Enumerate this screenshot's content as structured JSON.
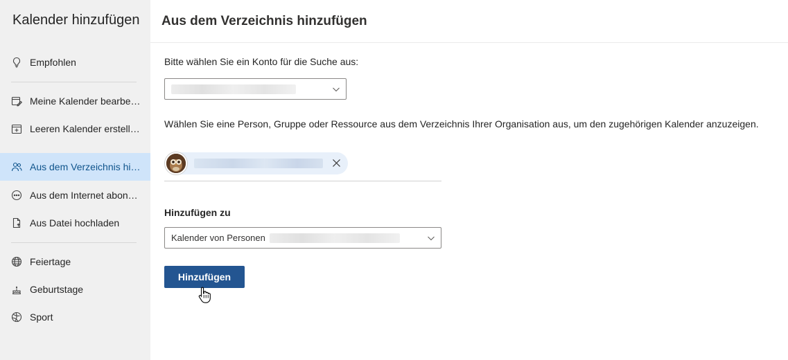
{
  "sidebar": {
    "title": "Kalender hinzufügen",
    "items": [
      {
        "label": "Empfohlen",
        "icon": "lightbulb-icon"
      },
      {
        "label": "Meine Kalender bearbeiten",
        "icon": "calendar-edit-icon"
      },
      {
        "label": "Leeren Kalender erstellen",
        "icon": "calendar-add-icon"
      },
      {
        "label": "Aus dem Verzeichnis hinzufügen",
        "icon": "people-directory-icon"
      },
      {
        "label": "Aus dem Internet abonnieren",
        "icon": "globe-subscribe-icon"
      },
      {
        "label": "Aus Datei hochladen",
        "icon": "document-upload-icon"
      },
      {
        "label": "Feiertage",
        "icon": "globe-icon"
      },
      {
        "label": "Geburtstage",
        "icon": "cake-icon"
      },
      {
        "label": "Sport",
        "icon": "sports-ball-icon"
      }
    ],
    "selected_index": 3
  },
  "main": {
    "title": "Aus dem Verzeichnis hinzufügen",
    "account_label": "Bitte wählen Sie ein Konto für die Suche aus:",
    "directory_hint": "Wählen Sie eine Person, Gruppe oder Ressource aus dem Verzeichnis Ihrer Organisation aus, um den zugehörigen Kalender anzuzeigen.",
    "add_to_label": "Hinzufügen zu",
    "add_to_value": "Kalender von Personen",
    "add_button": "Hinzufügen"
  },
  "colors": {
    "sidebar_bg": "#f0f0f0",
    "selected_bg": "#cfe4fa",
    "selected_text": "#0f548c",
    "primary": "#235591",
    "chip_bg": "#e8f0fa"
  }
}
